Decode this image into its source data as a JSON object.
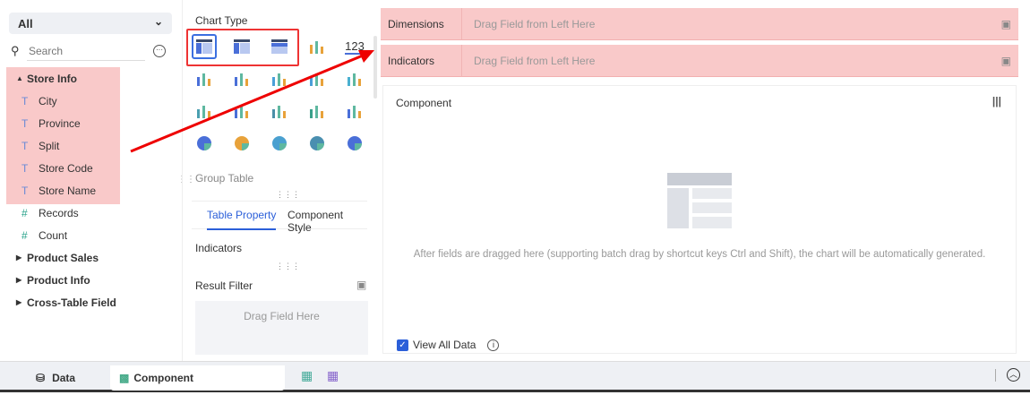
{
  "left": {
    "select": "All",
    "search_placeholder": "Search",
    "groups": [
      {
        "label": "Store Info",
        "expanded": true,
        "fields": [
          {
            "type": "text",
            "label": "City"
          },
          {
            "type": "text",
            "label": "Province"
          },
          {
            "type": "text",
            "label": "Split"
          },
          {
            "type": "text",
            "label": "Store Code"
          },
          {
            "type": "text",
            "label": "Store Name"
          },
          {
            "type": "number",
            "label": "Records"
          },
          {
            "type": "number",
            "label": "Count"
          }
        ]
      },
      {
        "label": "Product Sales"
      },
      {
        "label": "Product Info"
      },
      {
        "label": "Cross-Table Field"
      }
    ]
  },
  "mid": {
    "chart_type_title": "Chart Type",
    "number_icon": "123",
    "selected_type": "Group Table",
    "tabs": [
      "Table Property",
      "Component Style"
    ],
    "indicators": "Indicators",
    "result_filter": "Result Filter",
    "drag_here": "Drag Field Here"
  },
  "right": {
    "dimensions": "Dimensions",
    "indicators": "Indicators",
    "drag_placeholder": "Drag Field from Left Here",
    "component": "Component",
    "empty_msg": "After fields are dragged here (supporting batch drag by shortcut keys Ctrl and Shift), the chart will be automatically generated.",
    "view_all": "View All Data"
  },
  "bottom": {
    "data_tab": "Data",
    "component_tab": "Component"
  }
}
